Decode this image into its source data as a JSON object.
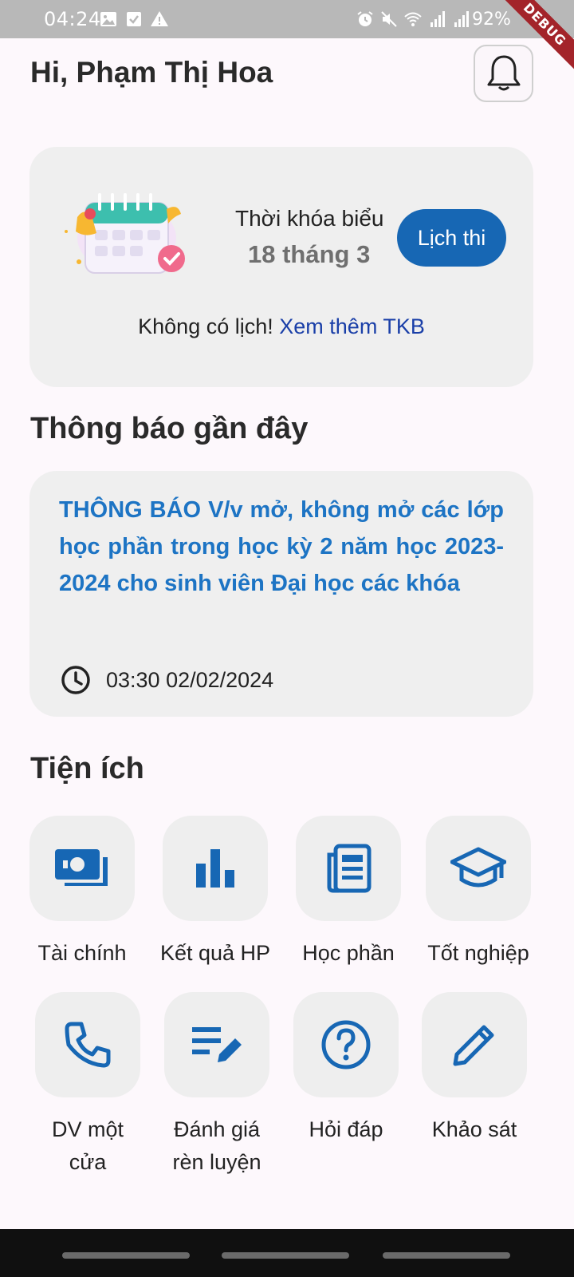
{
  "status_bar": {
    "time": "04:24",
    "battery": "92%",
    "debug_label": "DEBUG"
  },
  "header": {
    "greeting": "Hi, Phạm Thị Hoa"
  },
  "schedule": {
    "title": "Thời khóa biểu",
    "date": "18 tháng 3",
    "exam_button": "Lịch thi",
    "empty_text": "Không có lịch!",
    "more_link": "Xem thêm TKB"
  },
  "notifications": {
    "section_title": "Thông báo gần đây",
    "items": [
      {
        "title": "THÔNG BÁO V/v mở, không mở các lớp học phần trong học kỳ 2 năm học 2023-2024 cho sinh viên Đại học các khóa",
        "time": "03:30 02/02/2024"
      }
    ]
  },
  "utilities": {
    "section_title": "Tiện ích",
    "items": [
      {
        "label": "Tài chính",
        "icon": "money-icon"
      },
      {
        "label": "Kết quả HP",
        "icon": "bar-chart-icon"
      },
      {
        "label": "Học phần",
        "icon": "document-icon"
      },
      {
        "label": "Tốt nghiệp",
        "icon": "graduation-cap-icon"
      },
      {
        "label": "DV một cửa",
        "icon": "phone-icon"
      },
      {
        "label": "Đánh giá rèn luyện",
        "icon": "edit-list-icon"
      },
      {
        "label": "Hỏi đáp",
        "icon": "help-icon"
      },
      {
        "label": "Khảo sát",
        "icon": "pencil-icon"
      }
    ]
  },
  "colors": {
    "accent": "#1767b4",
    "link": "#1a3fa8",
    "notification_title": "#1d74c4",
    "card_background": "#efefef"
  }
}
